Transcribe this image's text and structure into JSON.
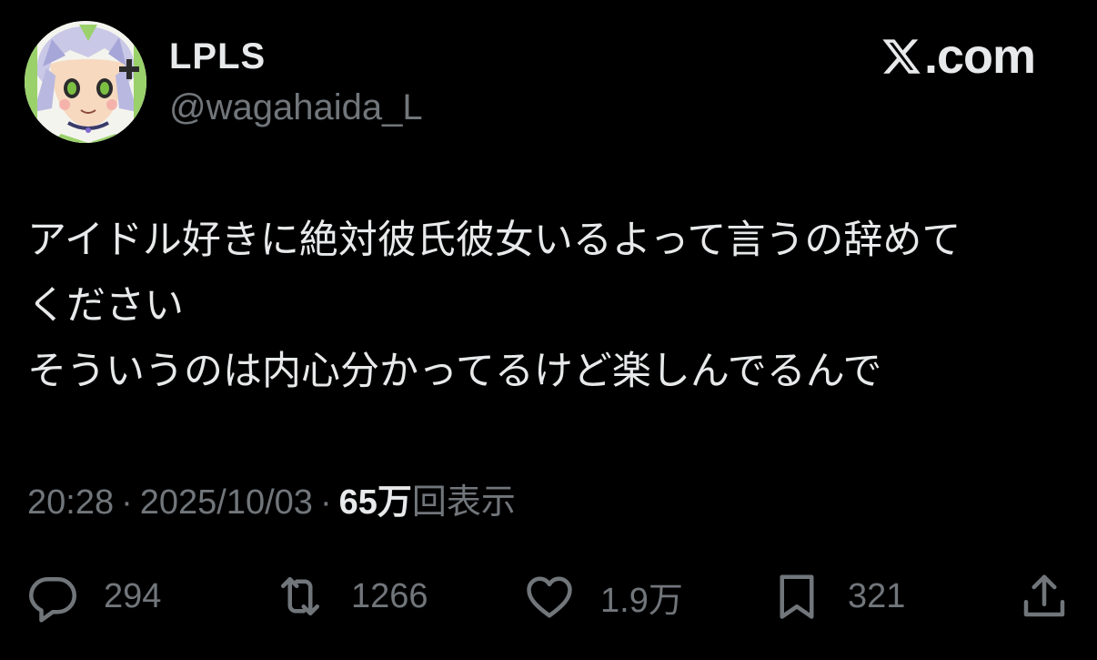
{
  "author": {
    "display_name": "LPLS",
    "handle": "@wagahaida_L",
    "avatar_icon": "avatar-illustration"
  },
  "brand": {
    "label": ".com",
    "icon": "x-logo-icon"
  },
  "tweet": {
    "lines": [
      "アイドル好きに絶対彼氏彼女いるよって言うの辞めて",
      "ください",
      "そういうのは内心分かってるけど楽しんでるんで"
    ]
  },
  "meta": {
    "time": "20:28",
    "separator": "·",
    "date": "2025/10/03",
    "views_count": "65万",
    "views_label": "回表示"
  },
  "actions": {
    "reply": {
      "icon": "reply-icon",
      "count": "294"
    },
    "repost": {
      "icon": "repost-icon",
      "count": "1266"
    },
    "like": {
      "icon": "heart-icon",
      "count": "1.9万"
    },
    "bookmark": {
      "icon": "bookmark-icon",
      "count": "321"
    },
    "share": {
      "icon": "share-icon"
    }
  },
  "colors": {
    "background": "#000000",
    "primary_text": "#e7e9ea",
    "secondary_text": "#71767b"
  }
}
